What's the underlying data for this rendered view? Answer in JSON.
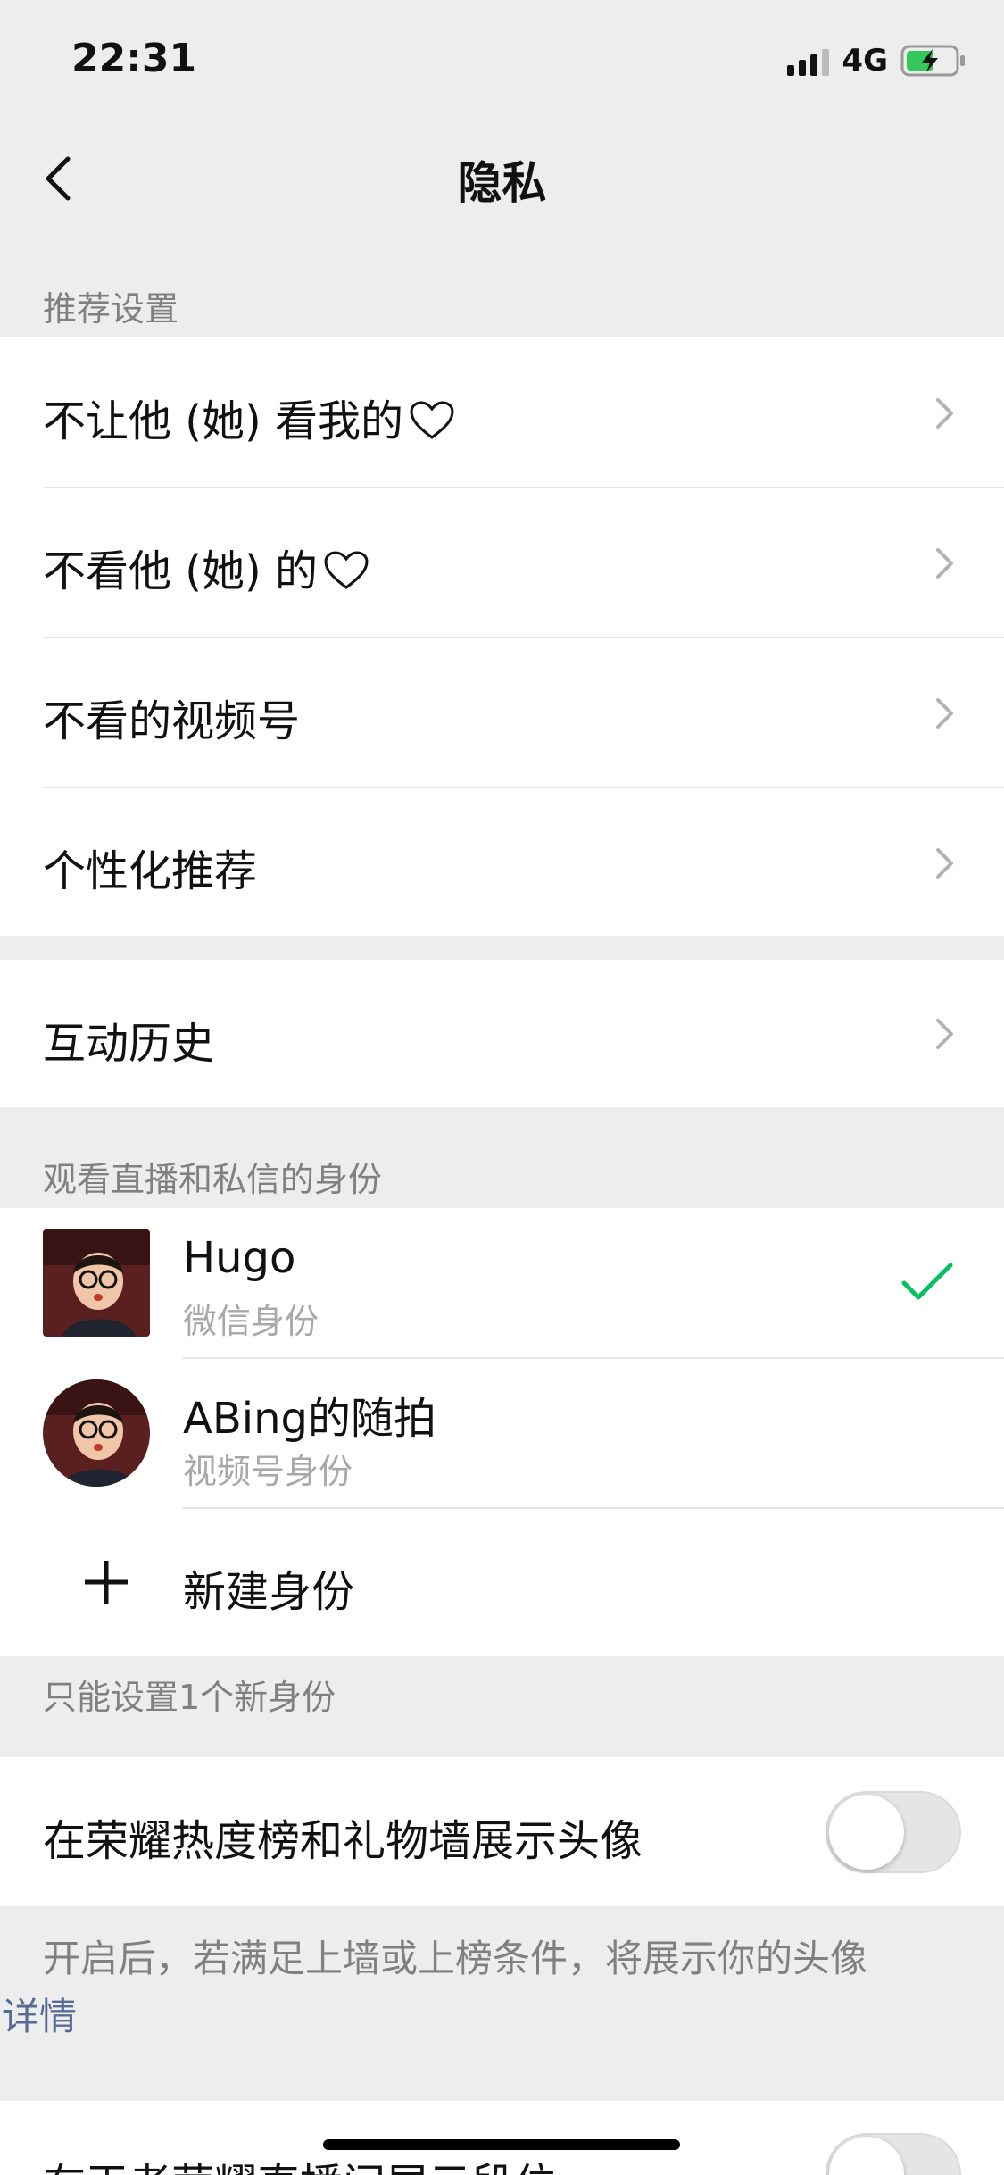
{
  "status_bar": {
    "time": "22:31",
    "network": "4G"
  },
  "nav": {
    "title": "隐私"
  },
  "recommend": {
    "section_label": "推荐设置",
    "items": [
      {
        "label": "不让他 (她) 看我的"
      },
      {
        "label": "不看他 (她) 的"
      },
      {
        "label": "不看的视频号"
      },
      {
        "label": "个性化推荐"
      }
    ]
  },
  "history": {
    "label": "互动历史"
  },
  "identity": {
    "section_label": "观看直播和私信的身份",
    "items": [
      {
        "name": "Hugo",
        "sub": "微信身份",
        "selected": true
      },
      {
        "name": "ABing的随拍",
        "sub": "视频号身份",
        "selected": false
      }
    ],
    "new_label": "新建身份",
    "note": "只能设置1个新身份"
  },
  "honor": {
    "label": "在荣耀热度榜和礼物墙展示头像",
    "enabled": false,
    "description": "开启后，若满足上墙或上榜条件，将展示你的头像",
    "detail_link": "详情"
  },
  "king": {
    "label": "在王者荣耀直播间展示段位",
    "enabled": false
  },
  "colors": {
    "accent": "#07c160",
    "link": "#576b95",
    "background": "#ededed"
  }
}
